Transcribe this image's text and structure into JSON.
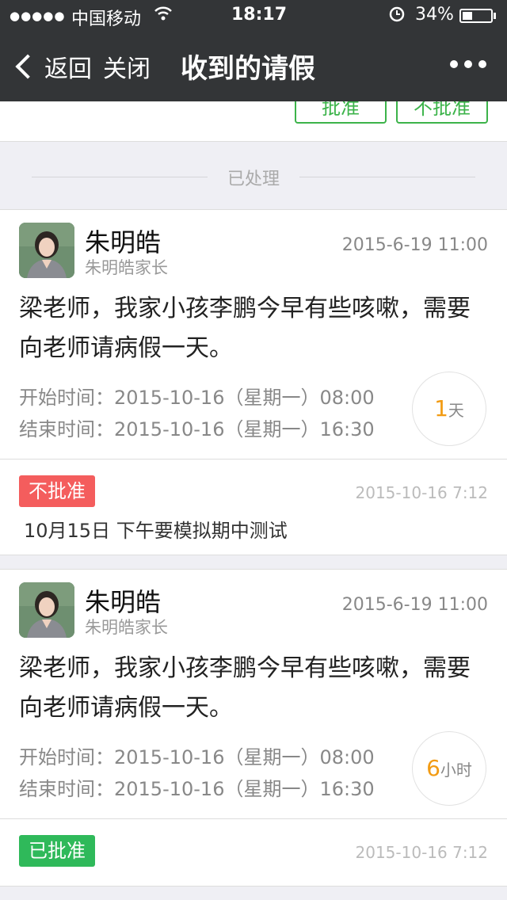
{
  "status_bar": {
    "carrier": "中国移动",
    "time": "18:17",
    "battery": "34%",
    "battery_level": 0.34
  },
  "nav": {
    "back_label": "返回",
    "close_label": "关闭",
    "title": "收到的请假"
  },
  "pending_actions": {
    "approve_label": "批准",
    "reject_label": "不批准"
  },
  "section": {
    "label": "已处理"
  },
  "requests": [
    {
      "name": "朱明皓",
      "role": "朱明皓家长",
      "date": "2015-6-19 11:00",
      "message": "梁老师，我家小孩李鹏今早有些咳嗽，需要向老师请病假一天。",
      "start": "开始时间：2015-10-16（星期一）08:00",
      "end": "结束时间：2015-10-16（星期一）16:30",
      "duration_value": "1",
      "duration_unit": "天",
      "status": "不批准",
      "response_date": "2015-10-16 7:12",
      "response_note": "10月15日 下午要模拟期中测试"
    },
    {
      "name": "朱明皓",
      "role": "朱明皓家长",
      "date": "2015-6-19 11:00",
      "message": "梁老师，我家小孩李鹏今早有些咳嗽，需要向老师请病假一天。",
      "start": "开始时间：2015-10-16（星期一）08:00",
      "end": "结束时间：2015-10-16（星期一）16:30",
      "duration_value": "6",
      "duration_unit": "小时",
      "status": "已批准",
      "response_date": "2015-10-16 7:12"
    }
  ],
  "colors": {
    "nav_bg": "#333537",
    "approve_green": "#3cb34a",
    "rejected_red": "#f45d5d",
    "approved_green": "#2fb95a",
    "duration_orange": "#f29b13"
  }
}
